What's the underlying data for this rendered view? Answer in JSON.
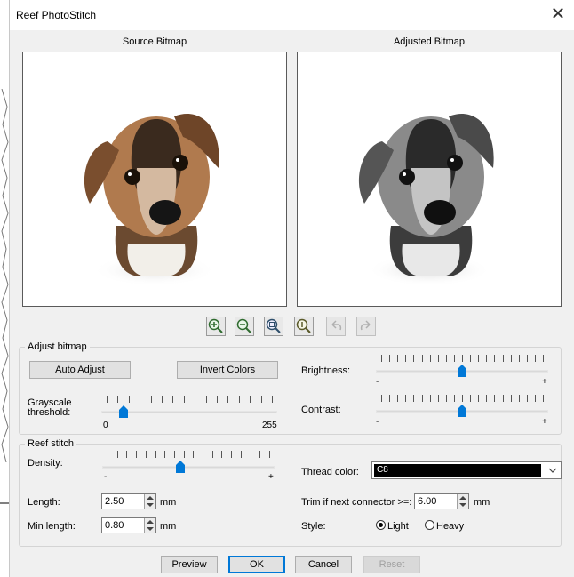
{
  "window": {
    "title": "Reef PhotoStitch",
    "close_glyph": "✕"
  },
  "source": {
    "title": "Source Bitmap"
  },
  "adjusted": {
    "title": "Adjusted Bitmap"
  },
  "toolbar": {
    "buttons": [
      {
        "name": "zoom-in",
        "icon": "zoom-in-icon"
      },
      {
        "name": "zoom-out",
        "icon": "zoom-out-icon"
      },
      {
        "name": "zoom-fit",
        "icon": "zoom-fit-icon"
      },
      {
        "name": "zoom-1to1",
        "icon": "zoom-1to1-icon"
      },
      {
        "name": "undo",
        "icon": "undo-icon"
      },
      {
        "name": "redo",
        "icon": "redo-icon"
      }
    ]
  },
  "adjust": {
    "group_label": "Adjust bitmap",
    "auto_adjust": "Auto Adjust",
    "invert_colors": "Invert Colors",
    "grayscale_label_1": "Grayscale",
    "grayscale_label_2": "threshold:",
    "grayscale_min": "0",
    "grayscale_max": "255",
    "grayscale_level": 0.1,
    "brightness_label": "Brightness:",
    "brightness_minus": "-",
    "brightness_plus": "+",
    "brightness_level": 0.5,
    "contrast_label": "Contrast:",
    "contrast_minus": "-",
    "contrast_plus": "+",
    "contrast_level": 0.5
  },
  "stitch": {
    "group_label": "Reef stitch",
    "density_label": "Density:",
    "density_minus": "-",
    "density_plus": "+",
    "density_level": 0.45,
    "length_label": "Length:",
    "length_value": "2.50",
    "length_unit": "mm",
    "min_length_label": "Min length:",
    "min_length_value": "0.80",
    "min_length_unit": "mm",
    "thread_color_label": "Thread color:",
    "thread_color_value": "C8",
    "trim_label": "Trim if next connector >=:",
    "trim_value": "6.00",
    "trim_unit": "mm",
    "style_label": "Style:",
    "style_light": "Light",
    "style_heavy": "Heavy",
    "style_selected": "Light"
  },
  "footer": {
    "preview": "Preview",
    "ok": "OK",
    "cancel": "Cancel",
    "reset": "Reset"
  },
  "colors": {
    "accent": "#0078d7",
    "thumb": "#0078d7",
    "dialog_bg": "#f0f0f0"
  }
}
